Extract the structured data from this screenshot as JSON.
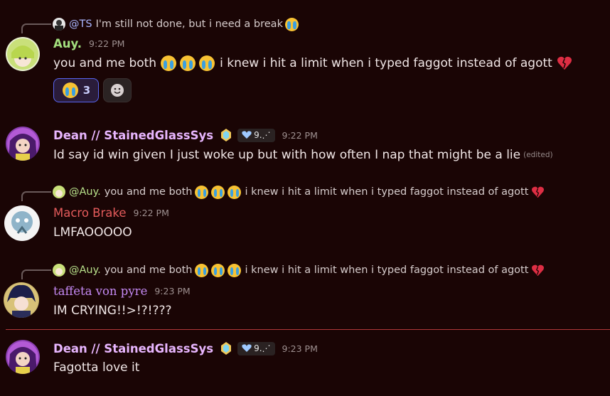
{
  "colors": {
    "background": "#1a0505",
    "auy": "#a3e07e",
    "dean": "#e8b6ff",
    "macro": "#e45b5b",
    "taffeta": "#c58af5",
    "mention_purple": "#a9b6ff",
    "mention_green": "#b7e08a",
    "divider": "#b0383a"
  },
  "messages": [
    {
      "reply": {
        "mention": "@TS",
        "text": "I'm still not done, but i need a break"
      },
      "username": "Auy.",
      "time": "9:22 PM",
      "text_a": "you and me both",
      "text_b": "i knew i hit a limit when i typed faggot instead of agott",
      "reactions": [
        {
          "emoji": "loudly-crying-face",
          "count": "3"
        },
        {
          "emoji": "add-reaction"
        }
      ]
    },
    {
      "username": "Dean // StainedGlassSys",
      "badge": "9.⋰",
      "time": "9:22 PM",
      "text": "Id say id win given I just woke up but with how often I nap that might be a lie",
      "edited": "(edited)"
    },
    {
      "reply": {
        "mention": "@Auy.",
        "text_a": "you and me both",
        "text_b": "i knew i hit a limit when i typed faggot instead of agott"
      },
      "username": "Macro Brake",
      "time": "9:22 PM",
      "text": "LMFAOOOOO"
    },
    {
      "reply": {
        "mention": "@Auy.",
        "text_a": "you and me both",
        "text_b": "i knew i hit a limit when i typed faggot instead of agott"
      },
      "username": "taffeta von pyre",
      "time": "9:23 PM",
      "text": "IM CRYING!!>!?!???"
    },
    {
      "username": "Dean // StainedGlassSys",
      "badge": "9.⋰",
      "time": "9:23 PM",
      "text": "Fagotta love it"
    }
  ]
}
